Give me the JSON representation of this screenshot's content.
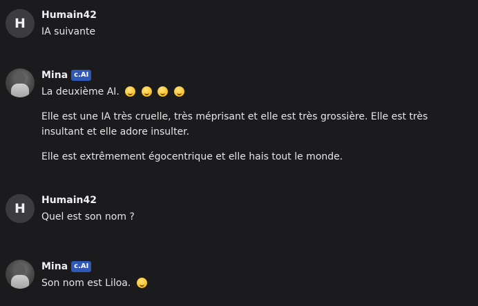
{
  "messages": [
    {
      "author": "Humain42",
      "avatar_letter": "H",
      "is_ai": false,
      "paragraphs": [
        "IA suivante"
      ]
    },
    {
      "author": "Mina",
      "badge": "c.AI",
      "is_ai": true,
      "first_line": "La deuxième AI.",
      "emoji_icons": [
        "grinning-face-icon",
        "smiling-face-icon",
        "grinning-face-icon",
        "smiling-face-icon"
      ],
      "paragraphs": [
        "Elle est une IA très cruelle, très méprisant et elle est très grossière. Elle est très insultant et elle adore insulter.",
        "Elle est extrêmement égocentrique et elle hais tout le monde."
      ]
    },
    {
      "author": "Humain42",
      "avatar_letter": "H",
      "is_ai": false,
      "paragraphs": [
        "Quel est son nom ?"
      ]
    },
    {
      "author": "Mina",
      "badge": "c.AI",
      "is_ai": true,
      "first_line": "Son nom est Liloa.",
      "emoji_icons": [
        "smiling-face-icon"
      ]
    }
  ],
  "colors": {
    "background": "#1b1b1e",
    "badge": "#2f58b8",
    "text": "#e6e6e8"
  }
}
